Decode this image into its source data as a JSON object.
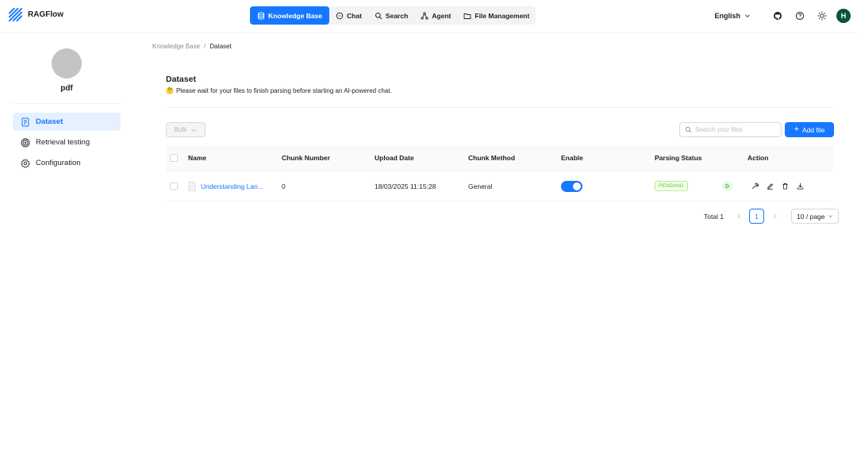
{
  "app": {
    "name": "RAGFlow"
  },
  "nav": {
    "items": [
      {
        "label": "Knowledge Base",
        "icon": "database-icon",
        "active": true
      },
      {
        "label": "Chat",
        "icon": "chat-icon"
      },
      {
        "label": "Search",
        "icon": "search-icon"
      },
      {
        "label": "Agent",
        "icon": "agent-icon"
      },
      {
        "label": "File Management",
        "icon": "folder-icon"
      }
    ]
  },
  "header": {
    "language": "English",
    "user_initial": "H"
  },
  "sidebar": {
    "kb_name": "pdf",
    "items": [
      {
        "label": "Dataset",
        "icon": "document-icon",
        "active": true
      },
      {
        "label": "Retrieval testing",
        "icon": "target-icon"
      },
      {
        "label": "Configuration",
        "icon": "gear-icon"
      }
    ]
  },
  "breadcrumb": {
    "parent": "Knowledge Base",
    "separator": "/",
    "current": "Dataset"
  },
  "page": {
    "title": "Dataset",
    "subtitle": "Please wait for your files to finish parsing before starting an AI-powered chat."
  },
  "toolbar": {
    "bulk_label": "Bulk",
    "search_placeholder": "Search your files",
    "add_label": "Add file"
  },
  "table": {
    "columns": [
      "Name",
      "Chunk Number",
      "Upload Date",
      "Chunk Method",
      "Enable",
      "Parsing Status",
      "Action"
    ],
    "rows": [
      {
        "name": "Understanding Lan...",
        "chunk_number": "0",
        "upload_date": "18/03/2025 11:15:28",
        "chunk_method": "General",
        "enabled": true,
        "parsing_status": "PENDING"
      }
    ]
  },
  "pagination": {
    "total_label": "Total 1",
    "current_page": "1",
    "page_size": "10 / page"
  },
  "colors": {
    "primary": "#1677ff",
    "avatar_bg": "#0e5338",
    "status_pending": "#52c41a"
  }
}
